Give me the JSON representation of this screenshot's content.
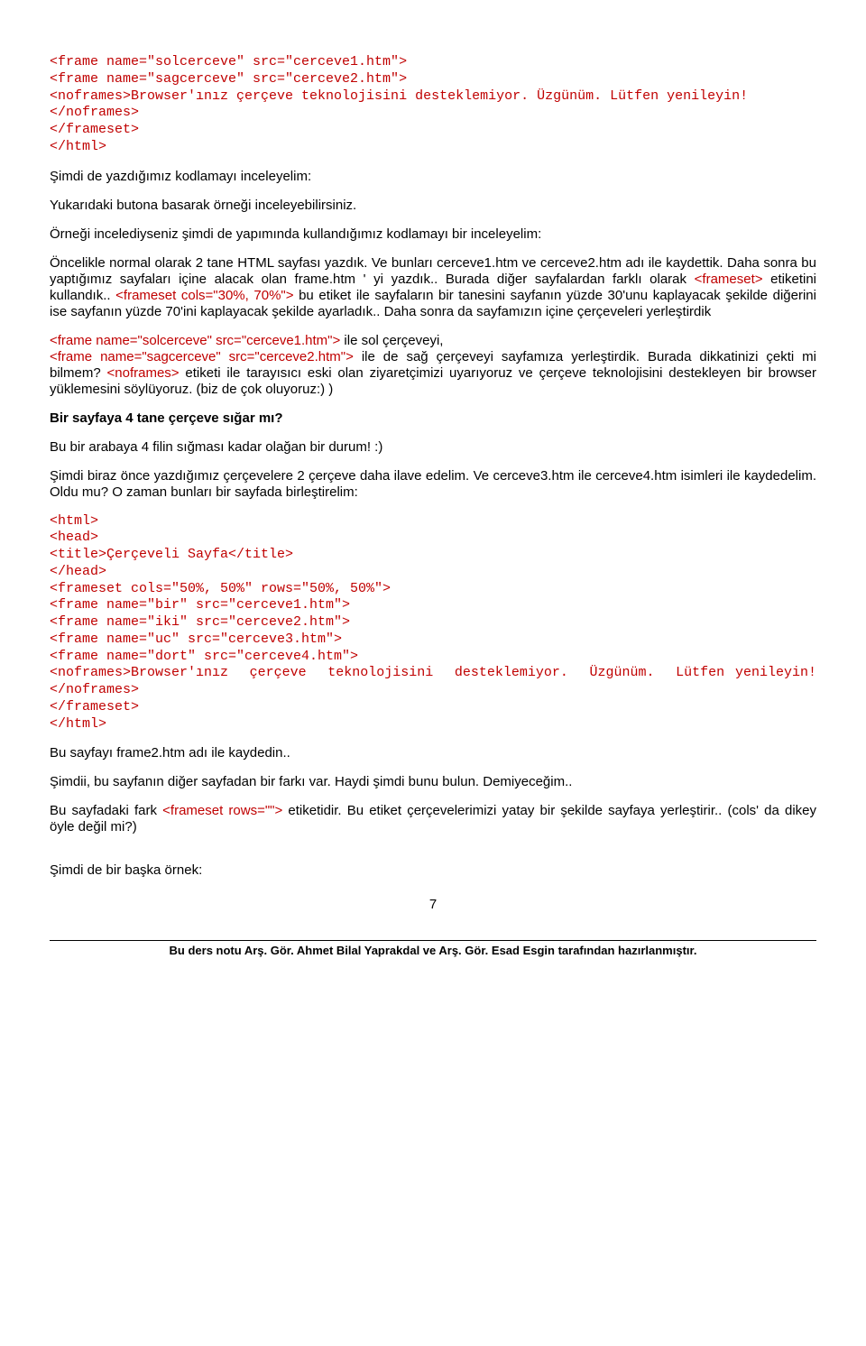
{
  "codeTop": "<frame name=\"solcerceve\" src=\"cerceve1.htm\">\n<frame name=\"sagcerceve\" src=\"cerceve2.htm\">\n<noframes>Browser'ınız çerçeve teknolojisini desteklemiyor. Üzgünüm. Lütfen yenileyin!</noframes>\n</frameset>\n</html>",
  "p1": "Şimdi de yazdığımız kodlamayı inceleyelim:",
  "p2": "Yukarıdaki butona basarak örneği inceleyebilirsiniz.",
  "p3": "Örneği incelediyseniz şimdi de yapımında kullandığımız kodlamayı bir inceleyelim:",
  "p4a": "Öncelikle normal olarak 2 tane HTML sayfası yazdık. Ve bunları cerceve1.htm ve cerceve2.htm adı ile kaydettik. Daha sonra bu yaptığımız sayfaları içine alacak olan frame.htm ' yi yazdık.. Burada diğer sayfalardan farklı olarak ",
  "p4red1": "<frameset>",
  "p4b": " etiketini kullandık.. ",
  "p4red2": "<frameset cols=\"30%, 70%\">",
  "p4c": " bu etiket ile sayfaların bir tanesini sayfanın yüzde 30'unu kaplayacak şekilde diğerini ise sayfanın yüzde 70'ini kaplayacak şekilde ayarladık.. Daha sonra da sayfamızın içine çerçeveleri yerleştirdik",
  "p5red1": "<frame name=\"solcerceve\" src=\"cerceve1.htm\">",
  "p5a": " ile sol çerçeveyi,",
  "p5red2": "<frame name=\"sagcerceve\" src=\"cerceve2.htm\">",
  "p5b": " ile de sağ çerçeveyi sayfamıza yerleştirdik. Burada dikkatinizi çekti mi bilmem? ",
  "p5red3": "<noframes>",
  "p5c": " etiketi ile tarayısıcı eski olan ziyaretçimizi uyarıyoruz ve çerçeve teknolojisini destekleyen bir browser yüklemesini söylüyoruz. (biz de çok oluyoruz:) )",
  "h1": "Bir sayfaya 4 tane çerçeve sığar mı?",
  "p6": "Bu bir arabaya 4 filin sığması kadar olağan bir durum! :)",
  "p7": "Şimdi biraz önce yazdığımız çerçevelere 2 çerçeve daha ilave edelim. Ve cerceve3.htm ile cerceve4.htm isimleri ile kaydedelim. Oldu mu? O zaman bunları bir sayfada birleştirelim:",
  "codeMid": "<html>\n<head>\n<title>Çerçeveli Sayfa</title>\n</head>\n<frameset cols=\"50%, 50%\" rows=\"50%, 50%\">\n<frame name=\"bir\" src=\"cerceve1.htm\">\n<frame name=\"iki\" src=\"cerceve2.htm\">\n<frame name=\"uc\" src=\"cerceve3.htm\">\n<frame name=\"dort\" src=\"cerceve4.htm\">\n<noframes>Browser'ınız  çerçeve  teknolojisini  desteklemiyor.  Üzgünüm.  Lütfen yenileyin!</noframes>\n</frameset>\n</html>",
  "p8": "Bu sayfayı frame2.htm adı ile kaydedin..",
  "p9": "Şimdii, bu sayfanın diğer sayfadan bir farkı var. Haydi şimdi bunu bulun. Demiyeceğim..",
  "p10a": "Bu sayfadaki fark ",
  "p10red": "<frameset rows=\"\">",
  "p10b": " etiketidir. Bu etiket çerçevelerimizi yatay bir şekilde sayfaya yerleştirir.. (cols' da dikey öyle değil mi?)",
  "p11": "Şimdi de bir başka örnek:",
  "pageNumber": "7",
  "footer": "Bu ders notu Arş. Gör. Ahmet Bilal Yaprakdal ve Arş. Gör. Esad Esgin tarafından hazırlanmıştır."
}
